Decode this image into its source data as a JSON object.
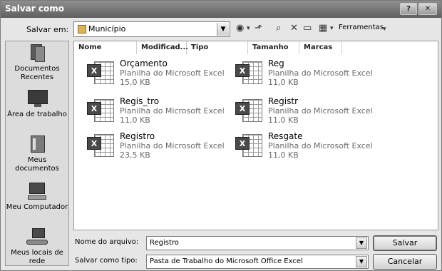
{
  "window": {
    "title": "Salvar como",
    "help_label": "?",
    "close_label": "✕"
  },
  "toolbar": {
    "save_in_label": "Salvar em:",
    "location": "Município",
    "tools_label": "Ferramentas"
  },
  "places": [
    {
      "label": "Documentos Recentes",
      "icon": "recent-documents-icon"
    },
    {
      "label": "Área de trabalho",
      "icon": "desktop-icon"
    },
    {
      "label": "Meus documentos",
      "icon": "my-documents-icon"
    },
    {
      "label": "Meu Computador",
      "icon": "my-computer-icon"
    },
    {
      "label": "Meus locais de rede",
      "icon": "network-places-icon"
    }
  ],
  "columns": [
    "Nome",
    "Modificad...",
    "Tipo",
    "Tamanho",
    "Marcas"
  ],
  "files": [
    {
      "name": "Orçamento",
      "type": "Planilha do Microsoft Excel",
      "size": "15,0 KB"
    },
    {
      "name": "Reg",
      "type": "Planilha do Microsoft Excel",
      "size": "11,0 KB"
    },
    {
      "name": "Regis_tro",
      "type": "Planilha do Microsoft Excel",
      "size": "11,0 KB"
    },
    {
      "name": "Registr",
      "type": "Planilha do Microsoft Excel",
      "size": "11,0 KB"
    },
    {
      "name": "Registro",
      "type": "Planilha do Microsoft Excel",
      "size": "23,5 KB"
    },
    {
      "name": "Resgate",
      "type": "Planilha do Microsoft Excel",
      "size": "11,0 KB"
    }
  ],
  "footer": {
    "filename_label": "Nome do arquivo:",
    "filename_value": "Registro",
    "filetype_label": "Salvar como tipo:",
    "filetype_value": "Pasta de Trabalho do Microsoft Office Excel",
    "save_button": "Salvar",
    "cancel_button": "Cancelar"
  },
  "colors": {
    "title_bar": "#6f6f6f",
    "dialog_bg": "#e6e6e6",
    "list_bg": "#ffffff"
  }
}
